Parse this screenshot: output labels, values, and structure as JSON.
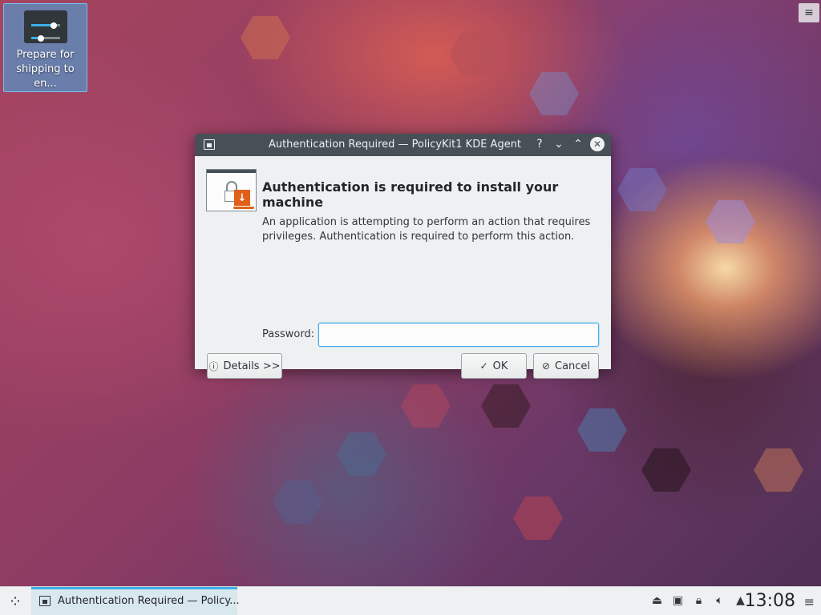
{
  "desktop": {
    "icon_label": "Prepare for shipping to en..."
  },
  "dialog": {
    "title": "Authentication Required — PolicyKit1 KDE Agent",
    "titlebar_buttons": {
      "help": "?",
      "minimize": "⌄",
      "maximize": "⌃",
      "close": "✕"
    },
    "heading": "Authentication is required to install your machine",
    "description": "An application is attempting to perform an action that requires privileges. Authentication is required to perform this action.",
    "password_label": "Password:",
    "password_value": "",
    "details_button": "Details >>",
    "ok_button": "OK",
    "cancel_button": "Cancel"
  },
  "taskbar": {
    "task_label": "Authentication Required — Policy...",
    "clock": "13:08"
  },
  "colors": {
    "accent": "#3daee9",
    "titlebar": "#475057",
    "dialog_bg": "#eff0f1"
  },
  "icons": {
    "desktop_icon": "sliders-icon",
    "dialog_icon": "lock-download-icon",
    "launcher": "kde-launcher-icon",
    "tray": [
      "usb-icon",
      "network-icon",
      "lock-icon",
      "volume-icon",
      "expand-tray-icon"
    ]
  }
}
